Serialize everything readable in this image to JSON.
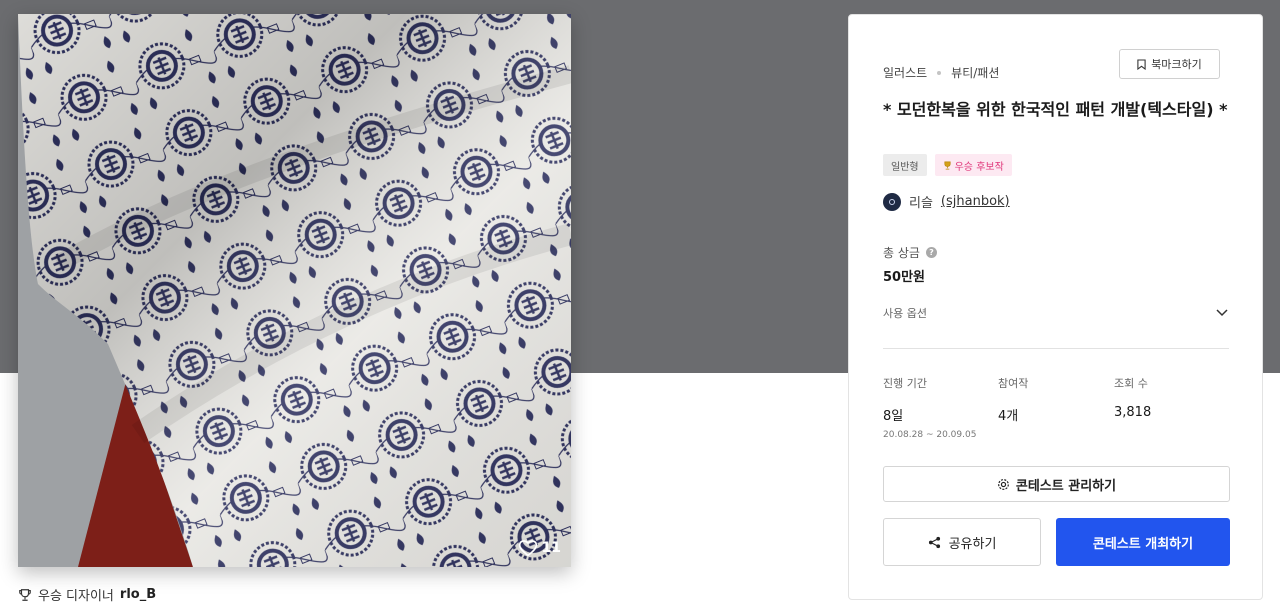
{
  "artwork": {
    "likes": "11",
    "colors": {
      "fabric": "#e9e8e4",
      "ink": "#2f3260",
      "underlay": "#7d1f18",
      "backdrop": "#9ea1a4"
    }
  },
  "designer": {
    "label": "우승 디자이너",
    "name": "rlo_B"
  },
  "contest": {
    "breadcrumb": [
      "일러스트",
      "뷰티/패션"
    ],
    "bookmark_label": "북마크하기",
    "title": "* 모던한복을 위한 한국적인 패턴 개발(텍스타일) *",
    "badges": {
      "type": "일반형",
      "candidate": "우승 후보작"
    },
    "author": {
      "name": "리슬",
      "handle": "(sjhanbok)"
    },
    "prize": {
      "label": "총 상금",
      "value": "50만원"
    },
    "options_label": "사용 옵션",
    "stats": {
      "period": {
        "label": "진행 기간",
        "value": "8일",
        "range": "20.08.28 ~ 20.09.05"
      },
      "entries": {
        "label": "참여작",
        "value": "4개"
      },
      "views": {
        "label": "조회 수",
        "value": "3,818"
      }
    },
    "manage_label": "콘테스트 관리하기",
    "share_label": "공유하기",
    "host_label": "콘테스트 개최하기"
  },
  "theme": {
    "top_band": "#6b6c6f",
    "primary": "#2255ee",
    "pink_badge": "#e0367a"
  }
}
